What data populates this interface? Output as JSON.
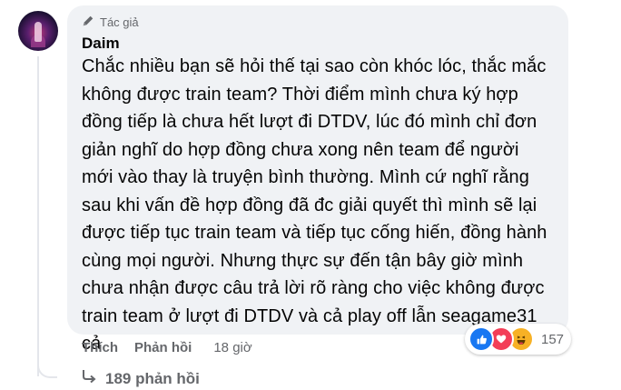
{
  "comment": {
    "badge": "Tác giả",
    "author": "Daim",
    "text": "Chắc nhiều bạn sẽ hỏi thế tại sao còn khóc lóc, thắc mắc không được train team? Thời điểm mình chưa ký hợp đồng tiếp là chưa hết lượt đi DTDV, lúc đó mình chỉ đơn giản nghĩ do hợp đồng chưa xong nên team để người mới vào thay là truyện bình thường. Mình cứ nghĩ rằng sau khi vấn đề hợp đồng đã đc giải quyết thì mình sẽ lại được tiếp tục train team và tiếp tục cống hiến, đồng hành cùng mọi người. Nhưng thực sự đến tận bây giờ mình chưa nhận được câu trả lời rõ ràng cho việc không được train team ở lượt đi DTDV và cả play off lẫn seagame31 cả"
  },
  "actions": {
    "like": "Thích",
    "reply": "Phản hồi",
    "time": "18 giờ"
  },
  "reactions": {
    "count": "157",
    "types": [
      "like-icon",
      "love-icon",
      "haha-icon"
    ]
  },
  "replies": {
    "label": "189 phản hồi"
  },
  "colors": {
    "bubble": "#f0f2f5",
    "secondary_text": "#65676b",
    "like": "#1877f2",
    "love": "#f33e58",
    "haha": "#f7b125"
  }
}
